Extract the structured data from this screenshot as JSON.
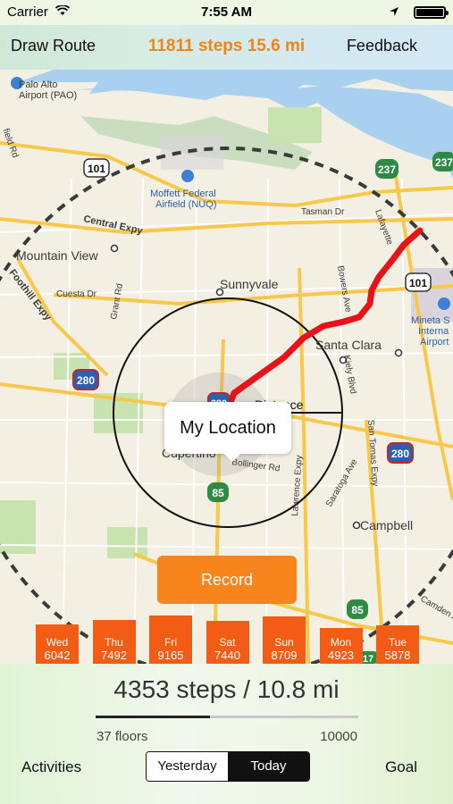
{
  "status": {
    "carrier": "Carrier",
    "time": "7:55 AM"
  },
  "nav": {
    "left": "Draw Route",
    "title": "11811 steps 15.6 mi",
    "right": "Feedback"
  },
  "map": {
    "labels": {
      "palo_alto": "Palo Alto",
      "airport_pao": "Airport (PAO)",
      "field_rd": "field Rd",
      "moffett1": "Moffett Federal",
      "moffett2": "Airfield (NUQ)",
      "tasman": "Tasman Dr",
      "lafayette": "Lafayette",
      "central_expy": "Central Expy",
      "mountain_view": "Mountain View",
      "foothill": "Foothill Expy",
      "cuesta": "Cuesta Dr",
      "grant": "Grant Rd",
      "sunnyvale": "Sunnyvale",
      "bowers": "Bowers Ave",
      "kiely": "Kiely Blvd",
      "mineta1": "Mineta S",
      "mineta2": "Interna",
      "mineta3": "Airport",
      "santa_clara": "Santa Clara",
      "distance": "Distance",
      "cupertino": "Cupertino",
      "bollinger": "Bollinger Rd",
      "lawrence": "Lawrence Expy",
      "saratoga": "Saratoga Ave",
      "san_tomas": "San Tomas Expy",
      "campbell": "Campbell",
      "camden": "Camden A",
      "hw101a": "101",
      "hw101b": "101",
      "hw237a": "237",
      "hw237b": "237",
      "hw280a": "280",
      "hw280b": "280",
      "hw280c": "280",
      "hw85a": "85",
      "hw85b": "85",
      "hw17": "17"
    },
    "bubble": "My Location",
    "record": "Record",
    "route_color": "#e8131a"
  },
  "days": [
    {
      "day": "Wed",
      "steps": "6042",
      "level": 6042
    },
    {
      "day": "Thu",
      "steps": "7492",
      "level": 7492
    },
    {
      "day": "Fri",
      "steps": "9165",
      "level": 9165
    },
    {
      "day": "Sat",
      "steps": "7440",
      "level": 7440
    },
    {
      "day": "Sun",
      "steps": "8709",
      "level": 8709
    },
    {
      "day": "Mon",
      "steps": "4923",
      "level": 4923
    },
    {
      "day": "Tue",
      "steps": "5878",
      "level": 5878
    }
  ],
  "summary": {
    "steps_text": "4353 steps / 10.8 mi",
    "progress": 0.4353,
    "floors": "37 floors",
    "goal_value": "10000"
  },
  "bottom": {
    "activities": "Activities",
    "yesterday": "Yesterday",
    "today": "Today",
    "goal": "Goal"
  },
  "colors": {
    "accent": "#f08417",
    "record": "#f7841d",
    "bars": "#f25c14"
  }
}
